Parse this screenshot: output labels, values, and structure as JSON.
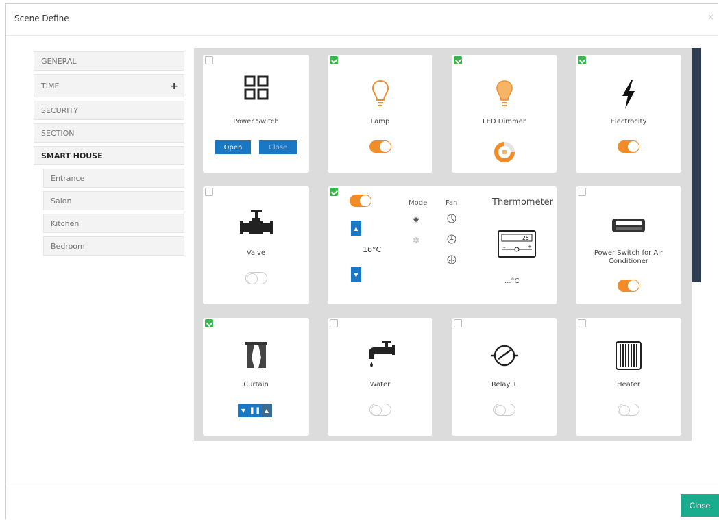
{
  "modal": {
    "title": "Scene Define",
    "close_x": "×",
    "close_button": "Close"
  },
  "sidebar": {
    "items": [
      {
        "label": "GENERAL"
      },
      {
        "label": "TIME",
        "plus": "+"
      },
      {
        "label": "SECURITY"
      },
      {
        "label": "SECTION"
      },
      {
        "label": "SMART HOUSE"
      }
    ],
    "sub_items": [
      {
        "label": "Entrance"
      },
      {
        "label": "Salon"
      },
      {
        "label": "Kitchen"
      },
      {
        "label": "Bedroom"
      }
    ]
  },
  "devices": {
    "power_switch": {
      "label": "Power Switch",
      "checked": false,
      "open_label": "Open",
      "close_label": "Close"
    },
    "lamp": {
      "label": "Lamp",
      "checked": true,
      "toggle": "on"
    },
    "led_dimmer": {
      "label": "LED Dimmer",
      "checked": true
    },
    "electricity": {
      "label": "Electrocity",
      "checked": true,
      "toggle": "on"
    },
    "valve": {
      "label": "Valve",
      "checked": false,
      "toggle": "off"
    },
    "thermo": {
      "checked": true,
      "toggle": "on",
      "mode_label": "Mode",
      "fan_label": "Fan",
      "temp": "16°C",
      "title": "Thermometer",
      "reading": "...°C",
      "display": "25"
    },
    "air_conditioner": {
      "label": "Power Switch for Air Conditioner",
      "checked": false,
      "toggle": "on"
    },
    "curtain": {
      "label": "Curtain",
      "checked": true
    },
    "water": {
      "label": "Water",
      "checked": false,
      "toggle": "off"
    },
    "relay": {
      "label": "Relay 1",
      "checked": false,
      "toggle": "off"
    },
    "heater": {
      "label": "Heater",
      "checked": false,
      "toggle": "off"
    }
  },
  "colors": {
    "accent": "#1977c3",
    "toggle_on": "#f28c28",
    "check": "#37b44a",
    "close_button": "#1aad8d"
  }
}
